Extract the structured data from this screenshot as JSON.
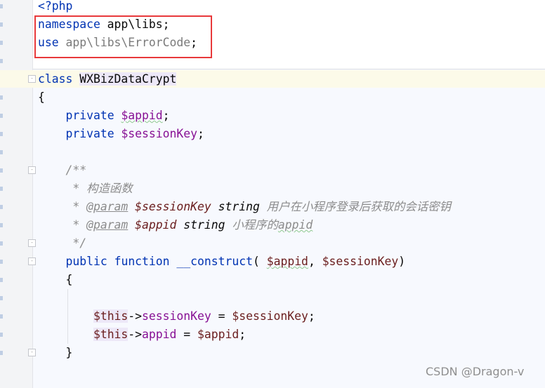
{
  "editor": {
    "lines": [
      [
        [
          "<?php",
          "kw"
        ]
      ],
      [
        [
          "namespace",
          "kw"
        ],
        [
          " app\\libs;",
          ""
        ]
      ],
      [
        [
          "use",
          "kw"
        ],
        [
          " ",
          ""
        ],
        [
          "app\\libs\\ErrorCode",
          "ns"
        ],
        [
          ";",
          ""
        ]
      ],
      [],
      [
        [
          "class",
          "kw"
        ],
        [
          " ",
          ""
        ],
        [
          "WXBizDataCrypt",
          "hl"
        ]
      ],
      [
        [
          "{",
          ""
        ]
      ],
      [
        [
          "    ",
          ""
        ],
        [
          "private",
          "kw"
        ],
        [
          " ",
          ""
        ],
        [
          "$appid",
          "fld wavy"
        ],
        [
          ";",
          ""
        ]
      ],
      [
        [
          "    ",
          ""
        ],
        [
          "private",
          "kw"
        ],
        [
          " ",
          ""
        ],
        [
          "$sessionKey",
          "fld"
        ],
        [
          ";",
          ""
        ]
      ],
      [],
      [
        [
          "    /**",
          "cm"
        ]
      ],
      [
        [
          "     * 构造函数",
          "cm"
        ]
      ],
      [
        [
          "     * ",
          "cm"
        ],
        [
          "@param",
          "tag"
        ],
        [
          " ",
          ""
        ],
        [
          "$sessionKey",
          "dv"
        ],
        [
          " string",
          "ty"
        ],
        [
          " 用户在小程序登录后获取的会话密钥",
          "cm"
        ]
      ],
      [
        [
          "     * ",
          "cm"
        ],
        [
          "@param",
          "tag"
        ],
        [
          " ",
          ""
        ],
        [
          "$appid",
          "dv"
        ],
        [
          " string",
          "ty"
        ],
        [
          " 小程序的",
          "cm"
        ],
        [
          "appid",
          "cm wavy"
        ]
      ],
      [
        [
          "     */",
          "cm"
        ]
      ],
      [
        [
          "    ",
          ""
        ],
        [
          "public",
          "kw"
        ],
        [
          " ",
          ""
        ],
        [
          "function",
          "kw"
        ],
        [
          " ",
          ""
        ],
        [
          "__construct",
          "kw"
        ],
        [
          "( ",
          ""
        ],
        [
          "$appid",
          "lv wavy"
        ],
        [
          ", ",
          ""
        ],
        [
          "$sessionKey",
          "lv"
        ],
        [
          ")",
          ""
        ]
      ],
      [
        [
          "    {",
          ""
        ]
      ],
      [],
      [
        [
          "        ",
          ""
        ],
        [
          "$this",
          "lv hl"
        ],
        [
          "->",
          ""
        ],
        [
          "sessionKey",
          "fld"
        ],
        [
          " = ",
          ""
        ],
        [
          "$sessionKey",
          "lv"
        ],
        [
          ";",
          ""
        ]
      ],
      [
        [
          "        ",
          ""
        ],
        [
          "$this",
          "lv hl"
        ],
        [
          "->",
          ""
        ],
        [
          "appid",
          "fld"
        ],
        [
          " = ",
          ""
        ],
        [
          "$appid",
          "lv"
        ],
        [
          ";",
          ""
        ]
      ],
      [
        [
          "    }",
          ""
        ]
      ]
    ]
  },
  "colors": {
    "keyword": "#0033b3",
    "field": "#871094",
    "variable": "#6a1d1d",
    "comment": "#8c8c8c",
    "highlight_box": "#e8393b"
  },
  "watermark": "CSDN @Dragon-v"
}
